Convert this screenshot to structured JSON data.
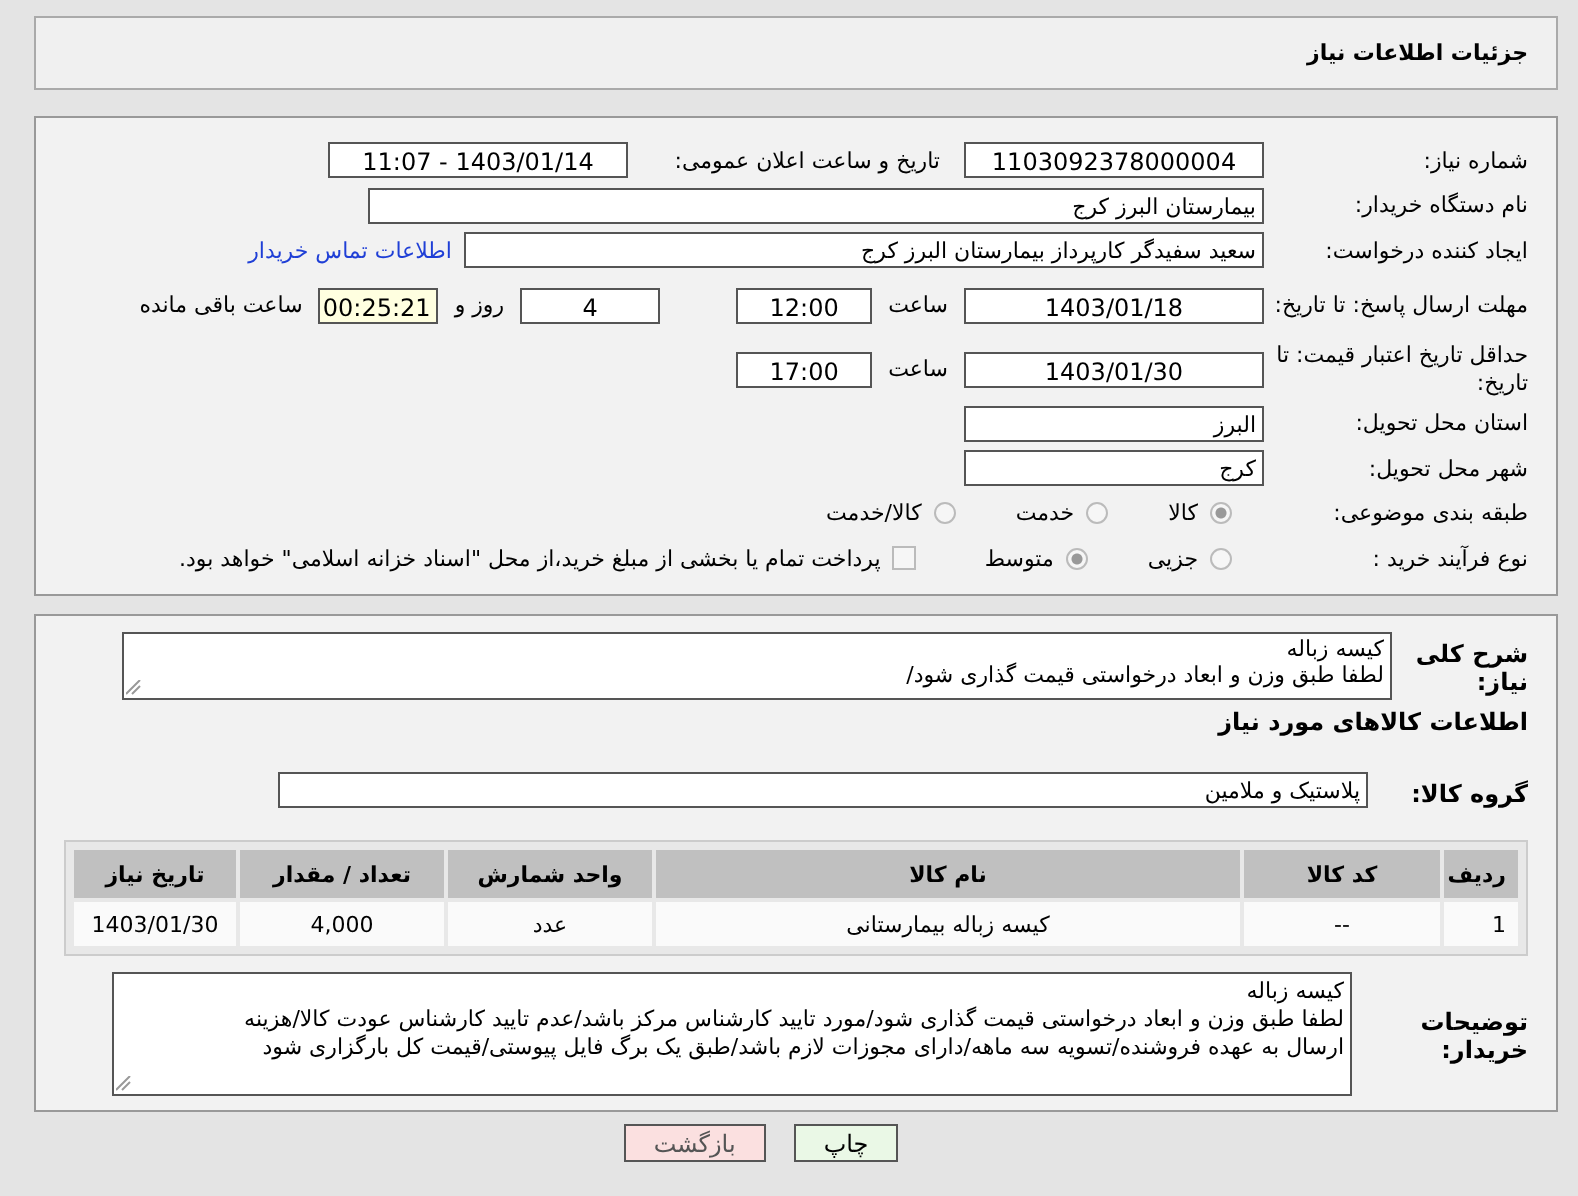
{
  "header": {
    "title": "جزئیات اطلاعات نیاز"
  },
  "need_number": {
    "label": "شماره نیاز:",
    "value": "1103092378000004"
  },
  "announce": {
    "label": "تاریخ و ساعت اعلان عمومی:",
    "value": "1403/01/14 - 11:07"
  },
  "buyer": {
    "label": "نام دستگاه خریدار:",
    "value": "بیمارستان البرز کرج"
  },
  "requester": {
    "label": "ایجاد کننده درخواست:",
    "value": "سعید سفیدگر کارپرداز بیمارستان البرز کرج",
    "link": "اطلاعات تماس خریدار"
  },
  "deadline": {
    "label": "مهلت ارسال پاسخ: تا تاریخ:",
    "date": "1403/01/18",
    "time_label": "ساعت",
    "time": "12:00",
    "days": "4",
    "days_label": "روز و",
    "remaining": "00:25:21",
    "remaining_label": "ساعت باقی مانده"
  },
  "validity": {
    "label": "حداقل تاریخ اعتبار قیمت: تا تاریخ:",
    "date": "1403/01/30",
    "time_label": "ساعت",
    "time": "17:00"
  },
  "province": {
    "label": "استان محل تحویل:",
    "value": "البرز"
  },
  "city": {
    "label": "شهر محل تحویل:",
    "value": "کرج"
  },
  "category": {
    "label": "طبقه بندی موضوعی:",
    "options": [
      {
        "label": "کالا",
        "selected": true
      },
      {
        "label": "خدمت",
        "selected": false
      },
      {
        "label": "کالا/خدمت",
        "selected": false
      }
    ]
  },
  "purchase_type": {
    "label": "نوع فرآیند خرید :",
    "options": [
      {
        "label": "جزیی",
        "selected": false
      },
      {
        "label": "متوسط",
        "selected": true
      }
    ],
    "payment": {
      "checked": false,
      "text": "پرداخت تمام یا بخشی از مبلغ خرید،از محل \"اسناد خزانه اسلامی\" خواهد بود."
    }
  },
  "summary": {
    "label": "شرح کلی نیاز:",
    "lines": [
      "کیسه زباله",
      "لطفا طبق وزن و ابعاد درخواستی قیمت گذاری شود/"
    ]
  },
  "goods_heading": "اطلاعات کالاهای مورد نیاز",
  "goods_group": {
    "label": "گروه کالا:",
    "value": "پلاستیک و ملامین"
  },
  "table": {
    "columns": [
      "ردیف",
      "کد کالا",
      "نام کالا",
      "واحد شمارش",
      "تعداد / مقدار",
      "تاریخ نیاز"
    ],
    "rows": [
      [
        "1",
        "--",
        "کیسه زباله بیمارستانی",
        "عدد",
        "4,000",
        "1403/01/30"
      ]
    ]
  },
  "buyer_notes": {
    "label": "توضیحات خریدار:",
    "lines": [
      "کیسه زباله",
      "لطفا طبق وزن و ابعاد درخواستی قیمت گذاری شود/مورد تایید کارشناس مرکز باشد/عدم تایید کارشناس عودت کالا/هزینه",
      "ارسال به عهده فروشنده/تسویه سه ماهه/دارای مجوزات لازم باشد/طبق یک برگ فایل پیوستی/قیمت کل بارگزاری شود"
    ]
  },
  "buttons": [
    {
      "label": "چاپ",
      "kind": "print"
    },
    {
      "label": "بازگشت",
      "kind": "back"
    }
  ]
}
